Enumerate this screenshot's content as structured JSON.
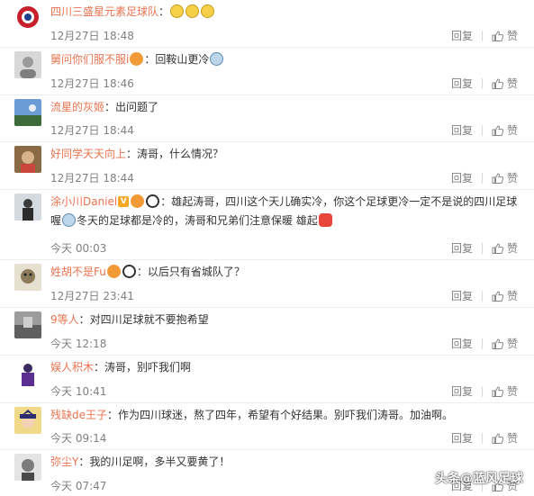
{
  "comments": [
    {
      "user": "四川三盛星元素足球队",
      "text": "：",
      "time": "12月27日 18:48",
      "emotes": [
        "sad",
        "sad",
        "sad"
      ]
    },
    {
      "user": "舅问你们服不服i",
      "text": "：回鞍山更冷",
      "time": "12月27日 18:46"
    },
    {
      "user": "流星的灰姬",
      "text": "：出问题了",
      "time": "12月27日 18:44"
    },
    {
      "user": "好同学天天向上",
      "text": "：涛哥，什么情况？",
      "time": "12月27日 18:44"
    },
    {
      "user": "涂小川Daniel",
      "text": "：雄起涛哥，四川这个天儿确实冷，你这个足球更冷一定不是说的四川足球喔",
      "text2": "冬天的足球都是冷的，涛哥和兄弟们注意保暖  雄起",
      "time": "今天 00:03"
    },
    {
      "user": "姓胡不是Fu",
      "text": "：以后只有省城队了？",
      "time": "12月27日 23:41"
    },
    {
      "user": "9等人",
      "text": "：对四川足球就不要抱希望",
      "time": "今天 12:18"
    },
    {
      "user": "娱人积木",
      "text": "：涛哥，别吓我们啊",
      "time": "今天 10:41"
    },
    {
      "user": "残缺de王子",
      "text": "：作为四川球迷，熬了四年，希望有个好结果。别吓我们涛哥。加油啊。",
      "time": "今天 09:14"
    },
    {
      "user": "弥尘Y",
      "text": "：我的川足啊，多半又要黄了！",
      "time": "今天 07:47"
    }
  ],
  "actions": {
    "reply": "回复",
    "like": "赞"
  },
  "watermark": "头条@蓝风足球",
  "colors": {
    "username": "#eb7350",
    "meta": "#808080"
  }
}
